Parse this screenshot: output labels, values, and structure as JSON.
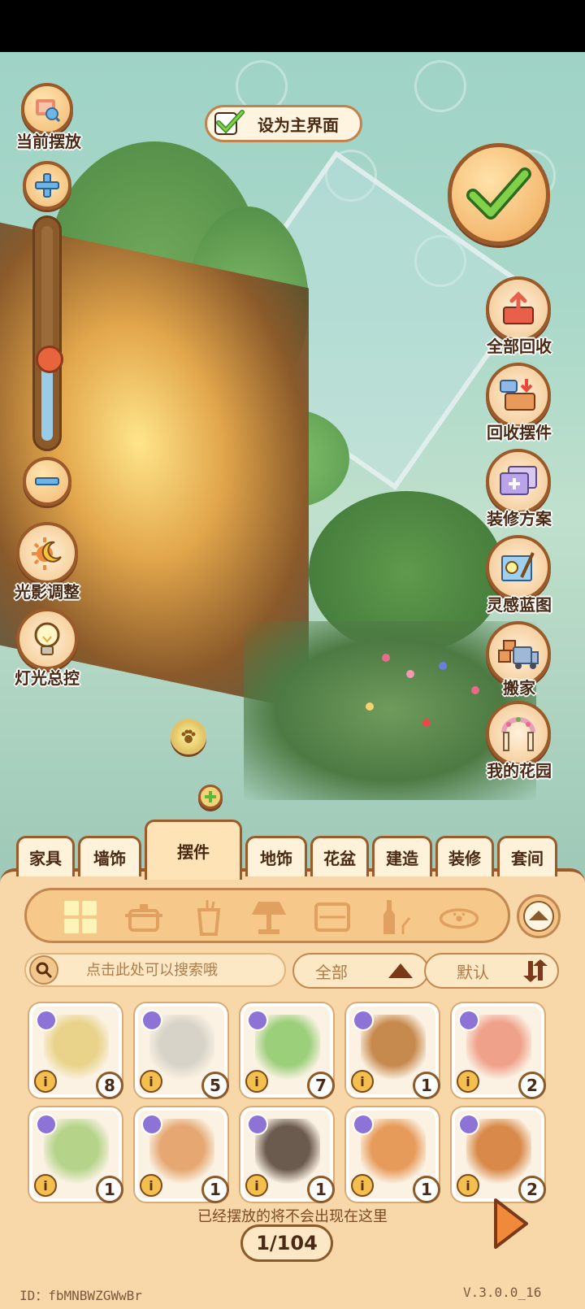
{
  "top_left": {
    "current_layout_label": "当前摆放"
  },
  "set_main": {
    "label": "设为主界面"
  },
  "left_tools": {
    "light_adjust_label": "光影调整",
    "light_control_label": "灯光总控"
  },
  "zoom": {
    "level": 0.38
  },
  "right_menu": {
    "recall_all": "全部回收",
    "recall_items": "回收摆件",
    "decor_plan": "装修方案",
    "inspiration": "灵感蓝图",
    "move_house": "搬家",
    "my_garden": "我的花园"
  },
  "tabs": [
    {
      "label": "家具"
    },
    {
      "label": "墙饰"
    },
    {
      "label": "摆件"
    },
    {
      "label": "地饰"
    },
    {
      "label": "花盆"
    },
    {
      "label": "建造"
    },
    {
      "label": "装修"
    },
    {
      "label": "套间"
    }
  ],
  "active_tab": "摆件",
  "category_icons": [
    "grid-icon",
    "pot-icon",
    "cup-icon",
    "lamp-icon",
    "pillow-icon",
    "bottle-icon",
    "pet-bowl-icon"
  ],
  "search": {
    "placeholder": "点击此处可以搜索哦"
  },
  "filter": {
    "scope_label": "全部",
    "sort_label": "默认"
  },
  "items": [
    {
      "name": "book-stack",
      "count": "8",
      "color": "#e9d38a"
    },
    {
      "name": "desk-lamp",
      "count": "5",
      "color": "#d8d3c8"
    },
    {
      "name": "potted-plant",
      "count": "7",
      "color": "#9bcf7a"
    },
    {
      "name": "book-pile",
      "count": "1",
      "color": "#c78a4e"
    },
    {
      "name": "otter-painting",
      "count": "2",
      "color": "#f0a18a"
    },
    {
      "name": "camping-stove",
      "count": "1",
      "color": "#b5d48a"
    },
    {
      "name": "fruit-basket",
      "count": "1",
      "color": "#e6a772"
    },
    {
      "name": "fossil-plate",
      "count": "1",
      "color": "#6b5a4e"
    },
    {
      "name": "backpack",
      "count": "1",
      "color": "#e79b5a"
    },
    {
      "name": "bread-loaf",
      "count": "2",
      "color": "#d98a4a"
    }
  ],
  "info_glyph": "i",
  "notice": "已经摆放的将不会出现在这里",
  "pager": {
    "text": "1/104"
  },
  "footer": {
    "id_text": "ID：fbMNBWZGWwBr",
    "version": "V.3.0.0_16"
  },
  "colors": {
    "panel": "#f8d8a8",
    "border": "#9b5a2a",
    "accent_green": "#5fb83a"
  }
}
